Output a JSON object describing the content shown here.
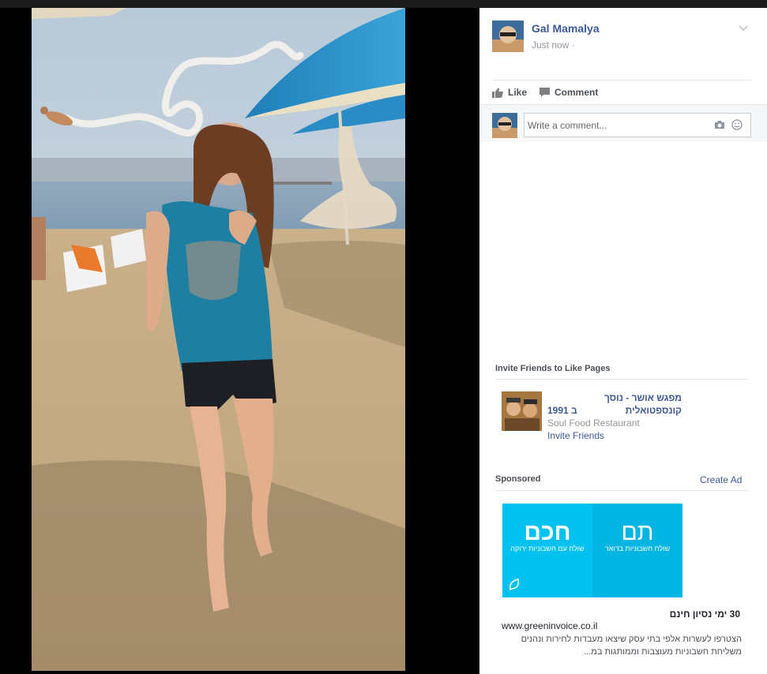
{
  "post": {
    "author": "Gal Mamalya",
    "timestamp": "Just now ·",
    "actions": {
      "like": "Like",
      "comment": "Comment"
    },
    "comment_placeholder": "Write a comment..."
  },
  "icons": {
    "menu": "chevron-down-icon",
    "like": "thumbs-up-icon",
    "comment": "speech-bubble-icon",
    "camera": "camera-icon",
    "emoji": "smiley-icon"
  },
  "invite_section": {
    "title": "Invite Friends to Like Pages",
    "page": {
      "name_line1": "מפגש אושר - נוסך קונספטואלית",
      "name_line2": "1991 ב",
      "category": "Soul Food Restaurant",
      "invite_label": "Invite Friends"
    }
  },
  "sponsored": {
    "title": "Sponsored",
    "create_ad": "Create Ad",
    "ad": {
      "left_big": "חכם",
      "left_small": "שולח עם חשבוניות ירוקה",
      "right_big": "תם",
      "right_small": "שולח חשבוניות בדואר",
      "headline": "30 ימי נסיון חינם",
      "url": "www.greeninvoice.co.il",
      "description": "הצטרפו לעשרות אלפי בתי עסק שיצאו מעבדות לחירות ונהנים משליחת חשבוניות מעוצבות וממותגות במ..."
    }
  },
  "colors": {
    "link": "#3b5998",
    "ad_cyan": "#00c1ef",
    "background": "#000000"
  }
}
